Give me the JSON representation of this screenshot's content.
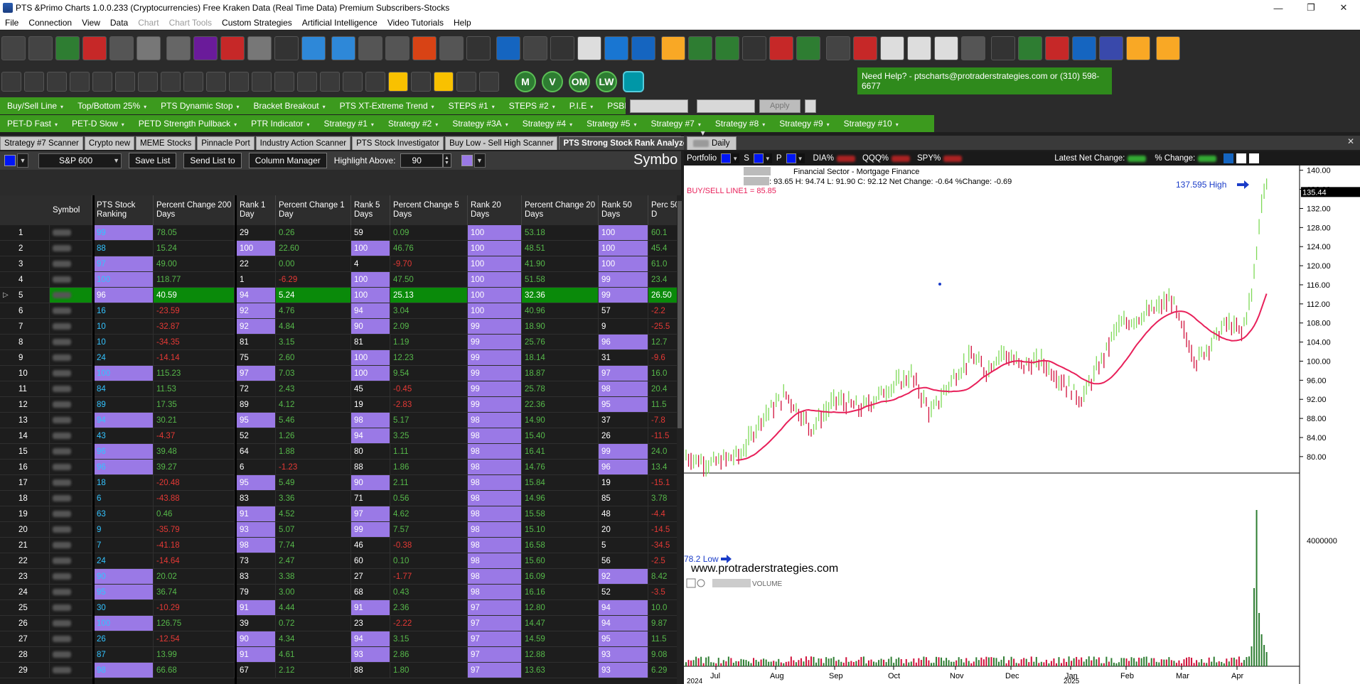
{
  "window": {
    "title": "PTS &Primo Charts 1.0.0.233  (Cryptocurrencies) Free Kraken Data (Real Time Data) Premium Subscribers-Stocks",
    "minimize": "—",
    "maximize": "❐",
    "close": "✕"
  },
  "menu": {
    "items": [
      "File",
      "Connection",
      "View",
      "Data",
      "Chart",
      "Chart Tools",
      "Custom Strategies",
      "Artificial Intelligence",
      "Video Tutorials",
      "Help"
    ]
  },
  "help": {
    "text": "Need Help? - ptscharts@protraderstrategies.com or (310) 598-6677"
  },
  "circle_buttons": [
    "M",
    "V",
    "OM",
    "LW"
  ],
  "strategy_bar1": [
    "Buy/Sell Line",
    "Top/Bottom 25%",
    "PTS Dynamic Stop",
    "Bracket Breakout",
    "PTS XT-Extreme Trend",
    "STEPS #1",
    "STEPS #2",
    "P.I.E",
    "PSBI"
  ],
  "apply_label": "Apply",
  "strategy_bar2": [
    "PET-D Fast",
    "PET-D Slow",
    "PETD Strength Pullback",
    "PTR Indicator",
    "Strategy #1",
    "Strategy #2",
    "Strategy #3A",
    "Strategy #4",
    "Strategy #5",
    "Strategy #7",
    "Strategy #8",
    "Strategy #9",
    "Strategy #10"
  ],
  "left_tabs": [
    "Strategy #7 Scanner",
    "Crypto new",
    "MEME Stocks",
    "Pinnacle Port",
    "Industry Action Scanner",
    "PTS Stock Investigator",
    "Buy Low - Sell High Scanner",
    "PTS Strong Stock Rank Analyzer"
  ],
  "right_tab": "Daily",
  "controls": {
    "index": "S&P 600",
    "save_list": "Save List",
    "send_list": "Send List to",
    "column_manager": "Column Manager",
    "highlight_label": "Highlight Above:",
    "highlight_value": "90",
    "symbol_heading": "Symbo"
  },
  "table": {
    "headers": [
      "Symbol",
      "PTS Stock Ranking",
      "Percent Change 200 Days",
      "Rank 1 Day",
      "Percent Change 1 Day",
      "Rank 5 Days",
      "Percent Change 5 Days",
      "Rank 20 Days",
      "Percent Change 20 Days",
      "Rank 50 Days",
      "Perc 50 D"
    ],
    "selected_row": 5,
    "rows": [
      {
        "n": "1",
        "rk": "99",
        "p200": "78.05",
        "r1": "29",
        "p1": "0.26",
        "r5": "59",
        "p5": "0.09",
        "r20": "100",
        "p20": "53.18",
        "r50": "100",
        "p50": "60.1"
      },
      {
        "n": "2",
        "rk": "88",
        "p200": "15.24",
        "r1": "100",
        "p1": "22.60",
        "r5": "100",
        "p5": "46.76",
        "r20": "100",
        "p20": "48.51",
        "r50": "100",
        "p50": "45.4"
      },
      {
        "n": "3",
        "rk": "97",
        "p200": "49.00",
        "r1": "22",
        "p1": "0.00",
        "r5": "4",
        "p5": "-9.70",
        "r20": "100",
        "p20": "41.90",
        "r50": "100",
        "p50": "61.0"
      },
      {
        "n": "4",
        "rk": "100",
        "p200": "118.77",
        "r1": "1",
        "p1": "-6.29",
        "r5": "100",
        "p5": "47.50",
        "r20": "100",
        "p20": "51.58",
        "r50": "99",
        "p50": "23.4"
      },
      {
        "n": "5",
        "rk": "96",
        "p200": "40.59",
        "r1": "94",
        "p1": "5.24",
        "r5": "100",
        "p5": "25.13",
        "r20": "100",
        "p20": "32.36",
        "r50": "99",
        "p50": "26.50"
      },
      {
        "n": "6",
        "rk": "16",
        "p200": "-23.59",
        "r1": "92",
        "p1": "4.76",
        "r5": "94",
        "p5": "3.04",
        "r20": "100",
        "p20": "40.96",
        "r50": "57",
        "p50": "-2.2"
      },
      {
        "n": "7",
        "rk": "10",
        "p200": "-32.87",
        "r1": "92",
        "p1": "4.84",
        "r5": "90",
        "p5": "2.09",
        "r20": "99",
        "p20": "18.90",
        "r50": "9",
        "p50": "-25.5"
      },
      {
        "n": "8",
        "rk": "10",
        "p200": "-34.35",
        "r1": "81",
        "p1": "3.15",
        "r5": "81",
        "p5": "1.19",
        "r20": "99",
        "p20": "25.76",
        "r50": "96",
        "p50": "12.7"
      },
      {
        "n": "9",
        "rk": "24",
        "p200": "-14.14",
        "r1": "75",
        "p1": "2.60",
        "r5": "100",
        "p5": "12.23",
        "r20": "99",
        "p20": "18.14",
        "r50": "31",
        "p50": "-9.6"
      },
      {
        "n": "10",
        "rk": "100",
        "p200": "115.23",
        "r1": "97",
        "p1": "7.03",
        "r5": "100",
        "p5": "9.54",
        "r20": "99",
        "p20": "18.87",
        "r50": "97",
        "p50": "16.0"
      },
      {
        "n": "11",
        "rk": "84",
        "p200": "11.53",
        "r1": "72",
        "p1": "2.43",
        "r5": "45",
        "p5": "-0.45",
        "r20": "99",
        "p20": "25.78",
        "r50": "98",
        "p50": "20.4"
      },
      {
        "n": "12",
        "rk": "89",
        "p200": "17.35",
        "r1": "89",
        "p1": "4.12",
        "r5": "19",
        "p5": "-2.83",
        "r20": "99",
        "p20": "22.36",
        "r50": "95",
        "p50": "11.5"
      },
      {
        "n": "13",
        "rk": "94",
        "p200": "30.21",
        "r1": "95",
        "p1": "5.46",
        "r5": "98",
        "p5": "5.17",
        "r20": "98",
        "p20": "14.90",
        "r50": "37",
        "p50": "-7.8"
      },
      {
        "n": "14",
        "rk": "43",
        "p200": "-4.37",
        "r1": "52",
        "p1": "1.26",
        "r5": "94",
        "p5": "3.25",
        "r20": "98",
        "p20": "15.40",
        "r50": "26",
        "p50": "-11.5"
      },
      {
        "n": "15",
        "rk": "96",
        "p200": "39.48",
        "r1": "64",
        "p1": "1.88",
        "r5": "80",
        "p5": "1.11",
        "r20": "98",
        "p20": "16.41",
        "r50": "99",
        "p50": "24.0"
      },
      {
        "n": "16",
        "rk": "96",
        "p200": "39.27",
        "r1": "6",
        "p1": "-1.23",
        "r5": "88",
        "p5": "1.86",
        "r20": "98",
        "p20": "14.76",
        "r50": "96",
        "p50": "13.4"
      },
      {
        "n": "17",
        "rk": "18",
        "p200": "-20.48",
        "r1": "95",
        "p1": "5.49",
        "r5": "90",
        "p5": "2.11",
        "r20": "98",
        "p20": "15.84",
        "r50": "19",
        "p50": "-15.1"
      },
      {
        "n": "18",
        "rk": "6",
        "p200": "-43.88",
        "r1": "83",
        "p1": "3.36",
        "r5": "71",
        "p5": "0.56",
        "r20": "98",
        "p20": "14.96",
        "r50": "85",
        "p50": "3.78"
      },
      {
        "n": "19",
        "rk": "63",
        "p200": "0.46",
        "r1": "91",
        "p1": "4.52",
        "r5": "97",
        "p5": "4.62",
        "r20": "98",
        "p20": "15.58",
        "r50": "48",
        "p50": "-4.4"
      },
      {
        "n": "20",
        "rk": "9",
        "p200": "-35.79",
        "r1": "93",
        "p1": "5.07",
        "r5": "99",
        "p5": "7.57",
        "r20": "98",
        "p20": "15.10",
        "r50": "20",
        "p50": "-14.5"
      },
      {
        "n": "21",
        "rk": "7",
        "p200": "-41.18",
        "r1": "98",
        "p1": "7.74",
        "r5": "46",
        "p5": "-0.38",
        "r20": "98",
        "p20": "16.58",
        "r50": "5",
        "p50": "-34.5"
      },
      {
        "n": "22",
        "rk": "24",
        "p200": "-14.64",
        "r1": "73",
        "p1": "2.47",
        "r5": "60",
        "p5": "0.10",
        "r20": "98",
        "p20": "15.60",
        "r50": "56",
        "p50": "-2.5"
      },
      {
        "n": "23",
        "rk": "90",
        "p200": "20.02",
        "r1": "83",
        "p1": "3.38",
        "r5": "27",
        "p5": "-1.77",
        "r20": "98",
        "p20": "16.09",
        "r50": "92",
        "p50": "8.42"
      },
      {
        "n": "24",
        "rk": "95",
        "p200": "36.74",
        "r1": "79",
        "p1": "3.00",
        "r5": "68",
        "p5": "0.43",
        "r20": "98",
        "p20": "16.16",
        "r50": "52",
        "p50": "-3.5"
      },
      {
        "n": "25",
        "rk": "30",
        "p200": "-10.29",
        "r1": "91",
        "p1": "4.44",
        "r5": "91",
        "p5": "2.36",
        "r20": "97",
        "p20": "12.80",
        "r50": "94",
        "p50": "10.0"
      },
      {
        "n": "26",
        "rk": "100",
        "p200": "126.75",
        "r1": "39",
        "p1": "0.72",
        "r5": "23",
        "p5": "-2.22",
        "r20": "97",
        "p20": "14.47",
        "r50": "94",
        "p50": "9.87"
      },
      {
        "n": "27",
        "rk": "26",
        "p200": "-12.54",
        "r1": "90",
        "p1": "4.34",
        "r5": "94",
        "p5": "3.15",
        "r20": "97",
        "p20": "14.59",
        "r50": "95",
        "p50": "11.5"
      },
      {
        "n": "28",
        "rk": "87",
        "p200": "13.99",
        "r1": "91",
        "p1": "4.61",
        "r5": "93",
        "p5": "2.86",
        "r20": "97",
        "p20": "12.88",
        "r50": "93",
        "p50": "9.08"
      },
      {
        "n": "29",
        "rk": "98",
        "p200": "66.68",
        "r1": "67",
        "p1": "2.12",
        "r5": "88",
        "p5": "1.80",
        "r20": "97",
        "p20": "13.63",
        "r50": "93",
        "p50": "6.29"
      }
    ]
  },
  "chart_top": {
    "portfolio": "Portfolio",
    "s_label": "S",
    "p_label": "P",
    "dia": "DIA%",
    "qqq": "QQQ%",
    "spy": "SPY%",
    "latest": "Latest Net Change:",
    "pct": "% Change:"
  },
  "chart": {
    "sector": "Financial Sector - Mortgage Finance",
    "ohlc": ": 93.65 H: 94.74 L: 91.90 C: 92.12 Net Change: -0.64  %Change: -0.69",
    "indicator": "BUY/SELL LINE1 = 85.85",
    "high_label": "137.595 High",
    "low_label": "78.2 Low",
    "watermark": "www.protraderstrategies.com",
    "volume_label": "VOLUME",
    "price_ticks": [
      "140.00",
      "136.00",
      "132.00",
      "128.00",
      "124.00",
      "120.00",
      "116.00",
      "112.00",
      "108.00",
      "104.00",
      "100.00",
      "96.00",
      "92.00",
      "88.00",
      "84.00",
      "80.00"
    ],
    "last_price": "135.44",
    "volume_tick": "4000000",
    "months": [
      "Jul",
      "Aug",
      "Sep",
      "Oct",
      "Nov",
      "Dec",
      "Jan",
      "Feb",
      "Mar",
      "Apr"
    ],
    "years": [
      "2024",
      "2025"
    ]
  },
  "colors": {
    "green": "#56b84a",
    "red": "#e53935",
    "cyan": "#33c3ff",
    "purple": "#9a79e6",
    "select": "#0a8a0a",
    "ma": "#e8205a"
  }
}
